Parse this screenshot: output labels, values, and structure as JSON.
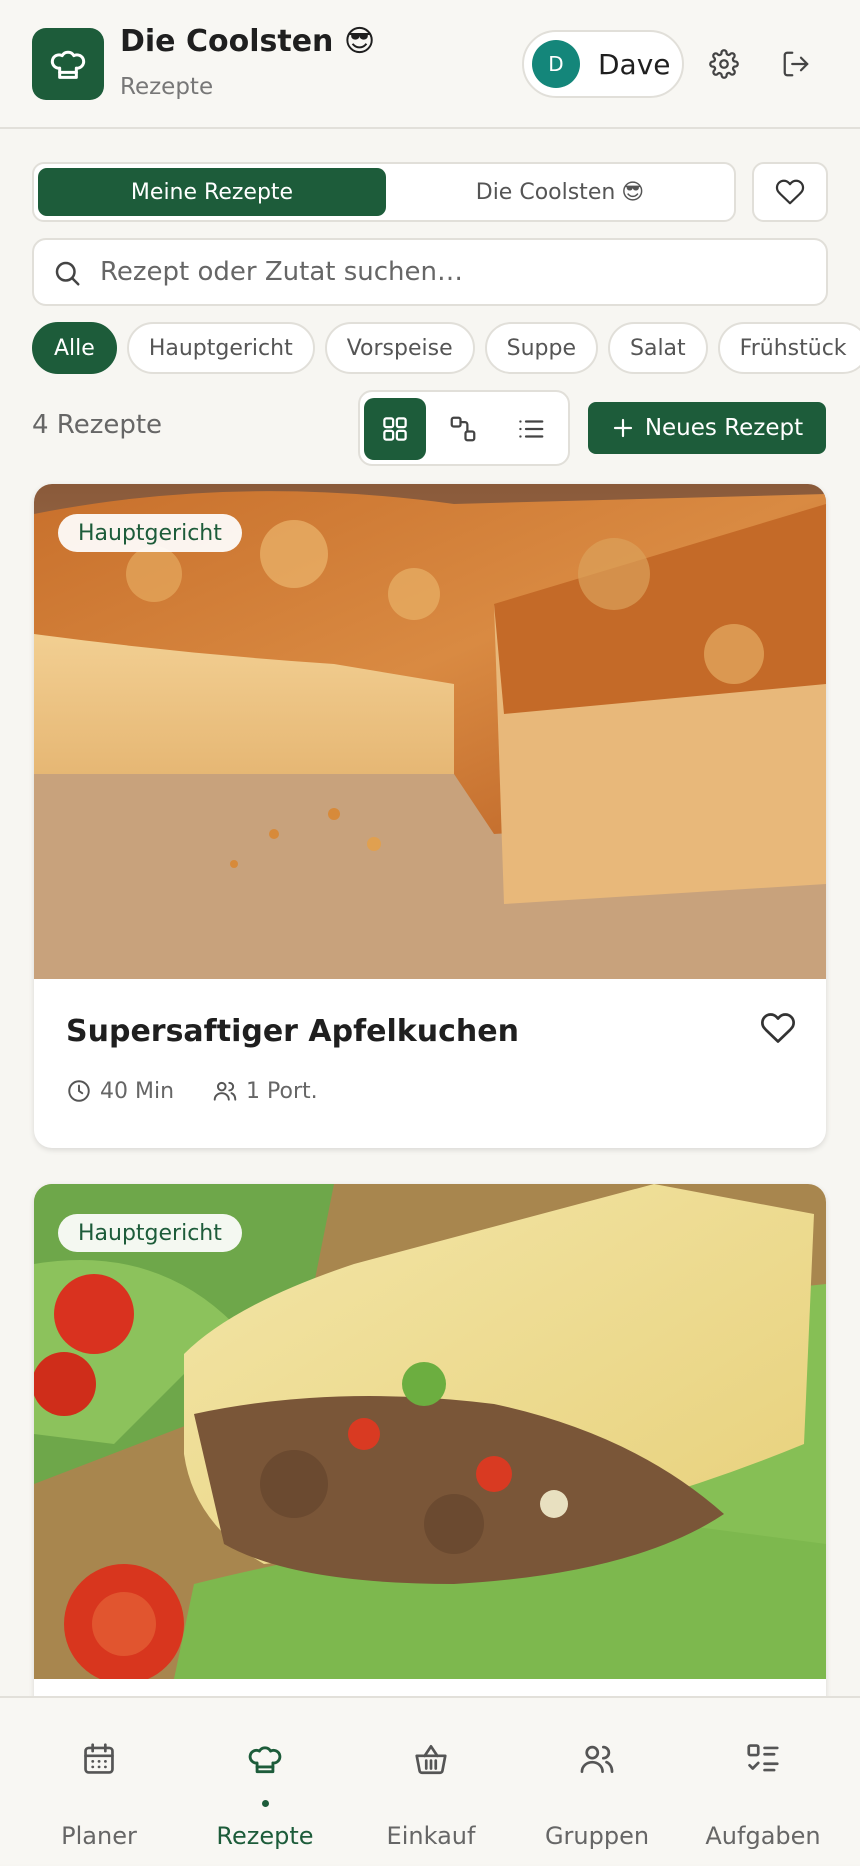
{
  "header": {
    "title": "Die Coolsten",
    "title_emoji": "😎",
    "subtitle": "Rezepte",
    "user": {
      "initial": "D",
      "name": "Dave"
    },
    "icons": [
      "chef-hat-icon",
      "gear-icon",
      "logout-icon"
    ]
  },
  "tabs": {
    "active": "Meine Rezepte",
    "inactive": "Die Coolsten",
    "inactive_emoji": "😎"
  },
  "search": {
    "placeholder": "Rezept oder Zutat suchen…"
  },
  "filters": [
    "Alle",
    "Hauptgericht",
    "Vorspeise",
    "Suppe",
    "Salat",
    "Frühstück"
  ],
  "toolbar": {
    "count": "4 Rezepte",
    "view_modes": [
      "grid-view-icon",
      "compact-view-icon",
      "list-view-icon"
    ],
    "new_button": "Neues Rezept"
  },
  "recipes": [
    {
      "category": "Hauptgericht",
      "title": "Supersaftiger Apfelkuchen",
      "time": "40 Min",
      "portions": "1 Port."
    },
    {
      "category": "Hauptgericht"
    }
  ],
  "nav": [
    {
      "label": "Planer",
      "icon": "calendar-icon"
    },
    {
      "label": "Rezepte",
      "icon": "chef-hat-icon",
      "active": true
    },
    {
      "label": "Einkauf",
      "icon": "basket-icon"
    },
    {
      "label": "Gruppen",
      "icon": "users-icon"
    },
    {
      "label": "Aufgaben",
      "icon": "tasks-icon"
    }
  ],
  "colors": {
    "primary": "#1d5c3a",
    "avatar": "#14867a",
    "background": "#f7f6f2"
  }
}
